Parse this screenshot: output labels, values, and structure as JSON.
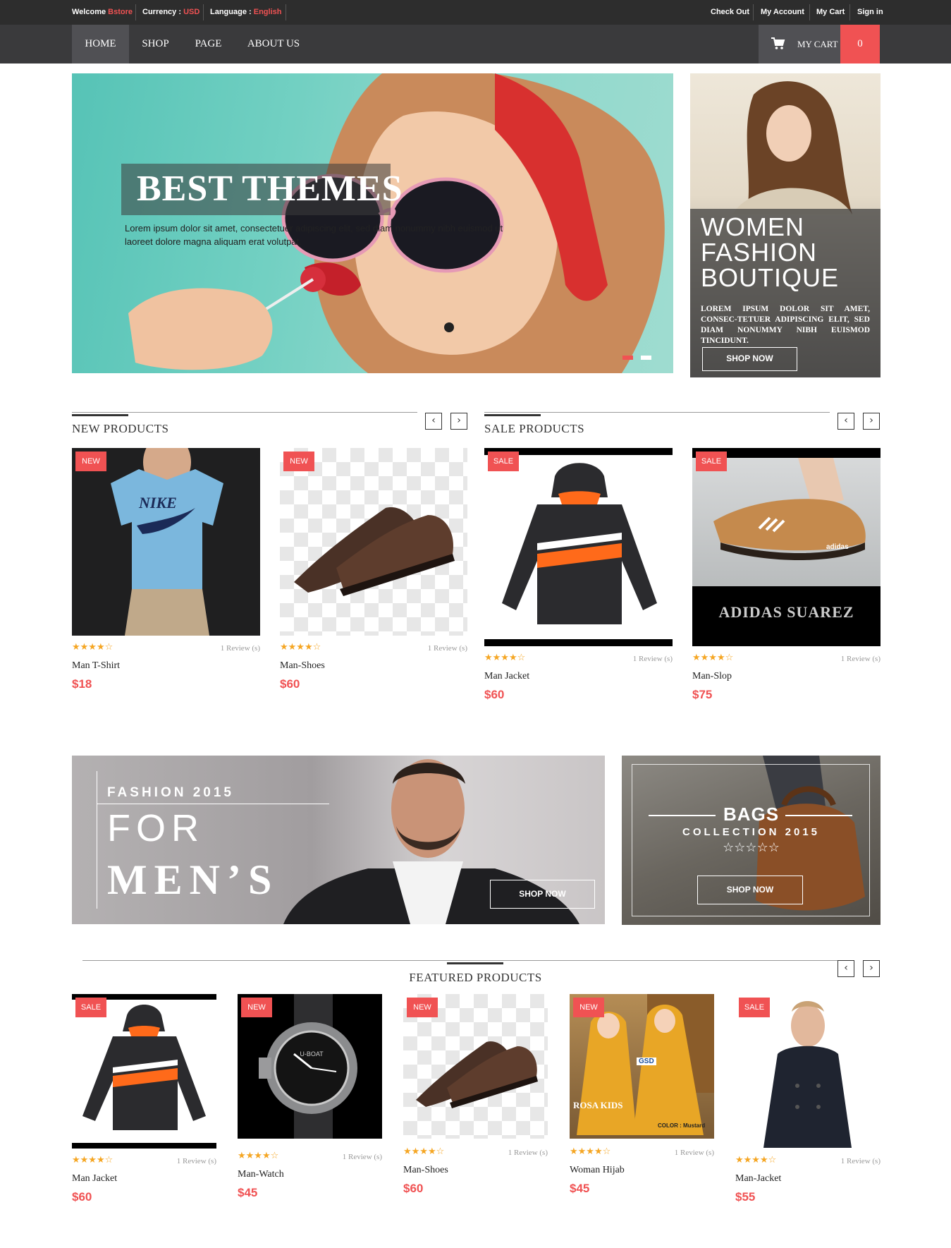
{
  "topbar": {
    "welcome_label": "Welcome",
    "welcome_user": "Bstore",
    "currency_label": "Currency :",
    "currency_value": "USD",
    "language_label": "Language :",
    "language_value": "English",
    "links": [
      "Check Out",
      "My Account",
      "My Cart",
      "Sign in"
    ]
  },
  "nav": {
    "items": [
      "HOME",
      "SHOP",
      "PAGE",
      "ABOUT US"
    ],
    "active": "HOME",
    "cart_label": "MY CART",
    "cart_count": "0"
  },
  "hero": {
    "title": "BEST THEMES",
    "text": "Lorem ipsum dolor sit amet, consectetuer adipiscing elit, sed diam nonummy nibh euismod ut laoreet dolore magna aliquam erat volutpat."
  },
  "side_banner": {
    "title_lines": [
      "WOMEN",
      "FASHION",
      "BOUTIQUE"
    ],
    "text": "LOREM IPSUM DOLOR SIT AMET, CONSEC-TETUER ADIPISCING ELIT, SED DIAM NONUMMY NIBH EUISMOD TINCIDUNT.",
    "button": "SHOP NOW"
  },
  "new_products": {
    "title": "NEW PRODUCTS",
    "items": [
      {
        "badge": "NEW",
        "name": "Man T-Shirt",
        "price": "$18",
        "reviews": "1 Review (s)",
        "rating": 3.5
      },
      {
        "badge": "NEW",
        "name": "Man-Shoes",
        "price": "$60",
        "reviews": "1 Review (s)",
        "rating": 3.5
      }
    ]
  },
  "sale_products": {
    "title": "SALE PRODUCTS",
    "items": [
      {
        "badge": "SALE",
        "name": "Man Jacket",
        "price": "$60",
        "reviews": "1 Review (s)",
        "rating": 3.5
      },
      {
        "badge": "SALE",
        "name": "Man-Slop",
        "price": "$75",
        "reviews": "1 Review (s)",
        "rating": 3.5,
        "image_text": "ADIDAS SUAREZ"
      }
    ]
  },
  "promo_men": {
    "line1": "FASHION 2015",
    "line2": "FOR",
    "line3": "MEN’S",
    "button": "SHOP NOW"
  },
  "promo_bags": {
    "line1": "BAGS",
    "line2": "COLLECTION 2015",
    "stars": "☆☆☆☆☆",
    "button": "SHOP NOW"
  },
  "featured_products": {
    "title": "FEATURED PRODUCTS",
    "items": [
      {
        "badge": "SALE",
        "name": "Man Jacket",
        "price": "$60",
        "reviews": "1 Review (s)",
        "rating": 4.5
      },
      {
        "badge": "NEW",
        "name": "Man-Watch",
        "price": "$45",
        "reviews": "1 Review (s)",
        "rating": 4.5
      },
      {
        "badge": "NEW",
        "name": "Man-Shoes",
        "price": "$60",
        "reviews": "1 Review (s)",
        "rating": 4.5
      },
      {
        "badge": "NEW",
        "name": "Woman Hijab",
        "price": "$45",
        "reviews": "1 Review (s)",
        "rating": 4.5,
        "image_texts": [
          "GSD",
          "ROSA KIDS",
          "COLOR : Mustard"
        ]
      },
      {
        "badge": "SALE",
        "name": "Man-Jacket",
        "price": "$55",
        "reviews": "1 Review (s)",
        "rating": 4.5
      }
    ]
  },
  "watch_text": "U-BOAT",
  "shoe_brand": "adidas",
  "stars_3_5": "★★★★☆",
  "stars_4_5": "★★★★☆",
  "colors": {
    "accent": "#f05253",
    "topbar": "#2d2d2d",
    "navbar": "#3a3a3c",
    "star": "#f5a623"
  }
}
